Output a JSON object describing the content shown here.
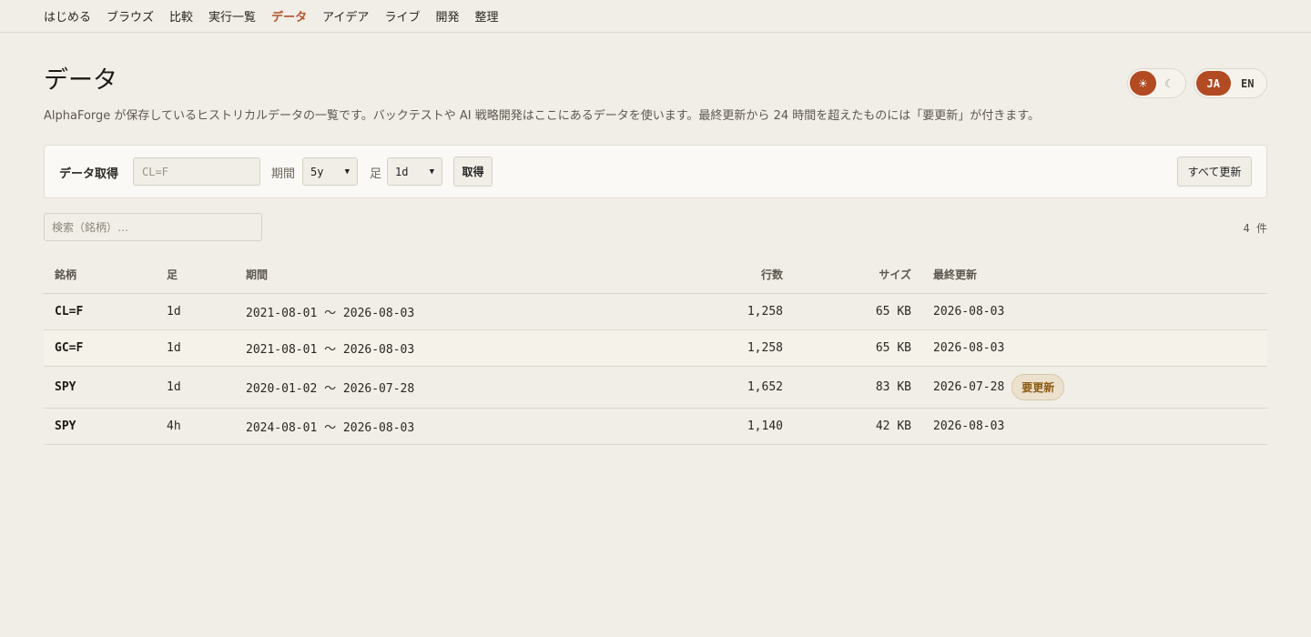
{
  "nav": {
    "items": [
      "はじめる",
      "ブラウズ",
      "比較",
      "実行一覧",
      "データ",
      "アイデア",
      "ライブ",
      "開発",
      "整理"
    ],
    "active_index": 4
  },
  "page": {
    "title": "データ",
    "description": "AlphaForge が保存しているヒストリカルデータの一覧です。バックテストや AI 戦略開発はここにあるデータを使います。最終更新から 24 時間を超えたものには「要更新」が付きます。"
  },
  "theme": {
    "light_icon": "☀",
    "dark_icon": "☾",
    "active": "light"
  },
  "lang": {
    "ja": "JA",
    "en": "EN",
    "active": "JA"
  },
  "fetch": {
    "title": "データ取得",
    "symbol_placeholder": "CL=F",
    "period_label": "期間",
    "period_value": "5y",
    "interval_label": "足",
    "interval_value": "1d",
    "fetch_button": "取得",
    "refresh_all_button": "すべて更新"
  },
  "search": {
    "placeholder": "検索（銘柄）…"
  },
  "count_text": "4 件",
  "table": {
    "headers": [
      "銘柄",
      "足",
      "期間",
      "行数",
      "サイズ",
      "最終更新"
    ],
    "rows": [
      {
        "symbol": "CL=F",
        "interval": "1d",
        "period": "2021-08-01 〜 2026-08-03",
        "rows": "1,258",
        "size": "65 KB",
        "updated": "2026-08-03",
        "badge": ""
      },
      {
        "symbol": "GC=F",
        "interval": "1d",
        "period": "2021-08-01 〜 2026-08-03",
        "rows": "1,258",
        "size": "65 KB",
        "updated": "2026-08-03",
        "badge": ""
      },
      {
        "symbol": "SPY",
        "interval": "1d",
        "period": "2020-01-02 〜 2026-07-28",
        "rows": "1,652",
        "size": "83 KB",
        "updated": "2026-07-28",
        "badge": "要更新"
      },
      {
        "symbol": "SPY",
        "interval": "4h",
        "period": "2024-08-01 〜 2026-08-03",
        "rows": "1,140",
        "size": "42 KB",
        "updated": "2026-08-03",
        "badge": ""
      }
    ]
  },
  "colors": {
    "accent": "#b24a22",
    "background": "#f1eee7",
    "badge_text": "#8a5a12"
  }
}
